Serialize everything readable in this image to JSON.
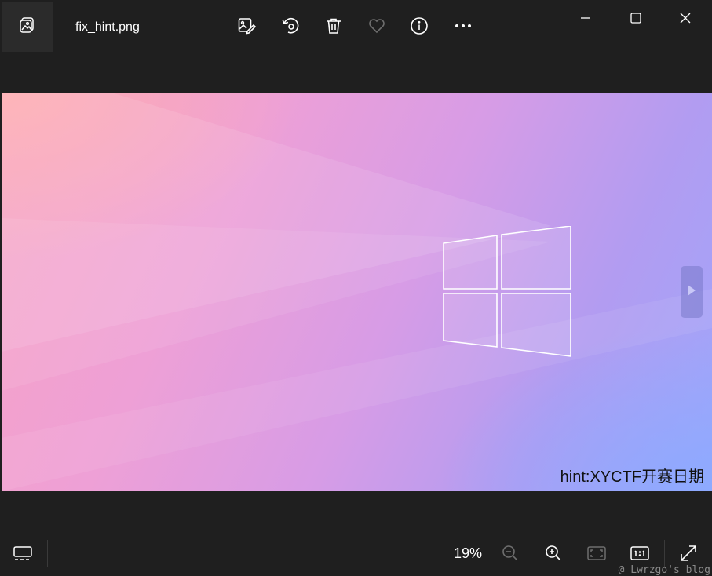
{
  "titlebar": {
    "file_name": "fix_hint.png",
    "app_icon": "photos-app-icon",
    "toolbar": [
      {
        "name": "edit-image-icon"
      },
      {
        "name": "rotate-icon"
      },
      {
        "name": "delete-icon"
      },
      {
        "name": "favorite-heart-icon"
      },
      {
        "name": "file-info-icon"
      },
      {
        "name": "more-options-icon"
      }
    ],
    "window_controls": [
      "minimize-icon",
      "maximize-icon",
      "close-icon"
    ]
  },
  "image": {
    "hint_text": "hint:XYCTF开赛日期",
    "next_icon": "next-arrow-icon"
  },
  "bottombar": {
    "zoom_level": "19%",
    "filmstrip_icon": "filmstrip-icon",
    "zoom_out_icon": "zoom-out-icon",
    "zoom_in_icon": "zoom-in-icon",
    "fit_icon": "fit-to-window-icon",
    "actual_size_icon": "actual-size-icon",
    "fullscreen_icon": "fullscreen-icon",
    "watermark": "@ Lwrzgo's blog"
  },
  "colors": {
    "chrome": "#1f1f1f",
    "text": "#ffffff",
    "disabled_icon": "#6e6e6e"
  }
}
